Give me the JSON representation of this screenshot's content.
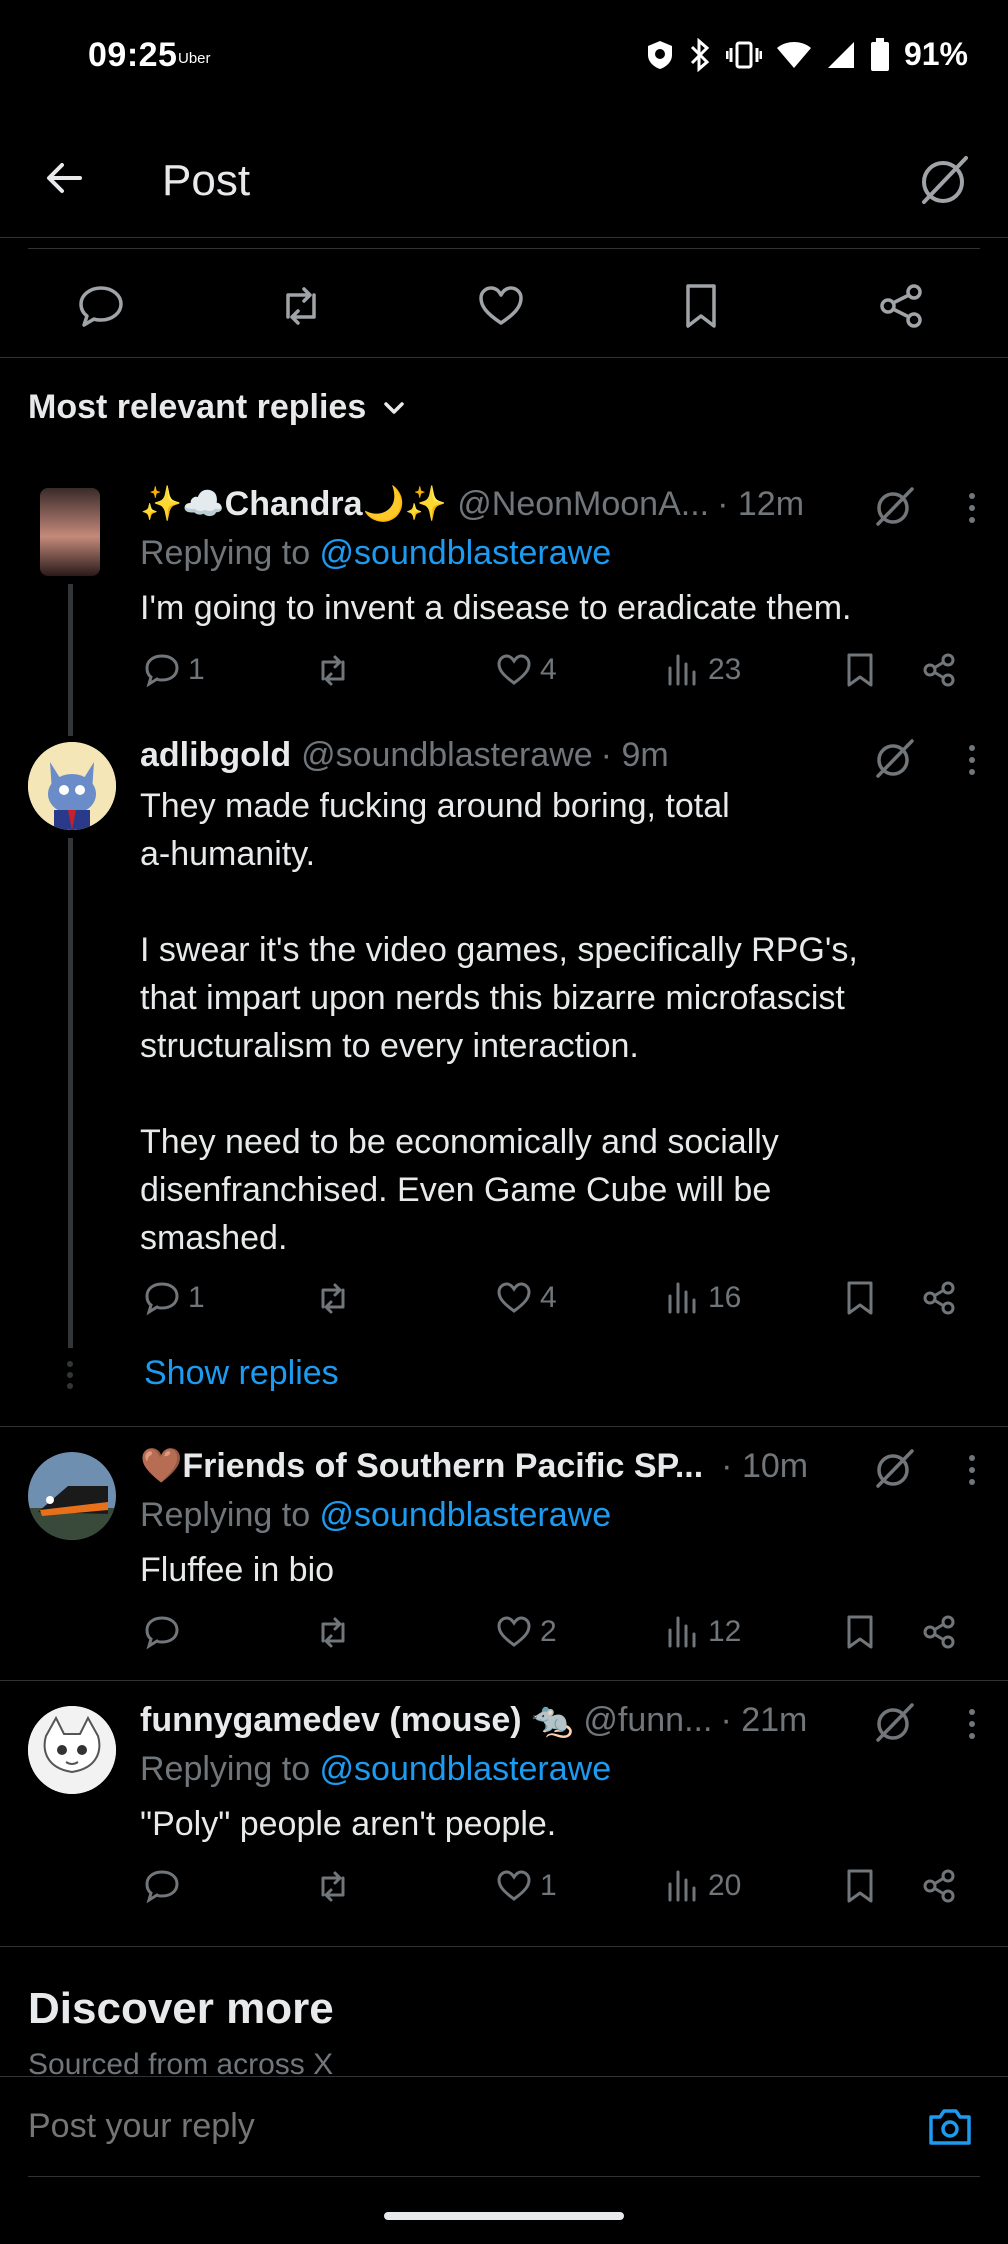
{
  "status_bar": {
    "time": "09:25",
    "carrier": "Uber",
    "battery": "91%"
  },
  "header": {
    "title": "Post",
    "back_icon": "arrow-left-icon",
    "grok_icon": "grok-icon"
  },
  "replies_header": {
    "label": "Most relevant replies"
  },
  "replies": [
    {
      "name": "✨☁️Chandra🌙✨",
      "handle": "@NeonMoonA...",
      "time": "· 12m",
      "replying_prefix": "Replying to ",
      "replying_to": "@soundblasterawe",
      "text": "I'm going to invent a disease to eradicate them.",
      "replies": "1",
      "likes": "4",
      "views": "23"
    },
    {
      "name": "adlibgold",
      "handle": "@soundblasterawe",
      "time": "· 9m",
      "text": "They made fucking around boring, total\na-humanity.\n\nI swear it's the video games, specifically RPG's,\nthat impart upon nerds this bizarre microfascist\nstructuralism to every interaction.\n\nThey need to be economically and socially\ndisenfranchised. Even Game Cube will be\nsmashed.",
      "replies": "1",
      "likes": "4",
      "views": "16",
      "show_replies": "Show replies"
    },
    {
      "name": "🤎Friends of Southern Pacific SP...",
      "handle": "",
      "time": "· 10m",
      "replying_prefix": "Replying to ",
      "replying_to": "@soundblasterawe",
      "text": "Fluffee in bio",
      "replies": "",
      "likes": "2",
      "views": "12"
    },
    {
      "name": "funnygamedev (mouse) 🐀",
      "handle": "@funn...",
      "time": "· 21m",
      "replying_prefix": "Replying to ",
      "replying_to": "@soundblasterawe",
      "text": "\"Poly\" people aren't people.",
      "replies": "",
      "likes": "1",
      "views": "20"
    }
  ],
  "discover": {
    "title": "Discover more",
    "subtitle": "Sourced from across X"
  },
  "composer": {
    "placeholder": "Post your reply"
  },
  "colors": {
    "background": "#000000",
    "text": "#e7e9ea",
    "muted": "#71767b",
    "accent": "#1d9bf0",
    "divider": "#2f3336"
  }
}
